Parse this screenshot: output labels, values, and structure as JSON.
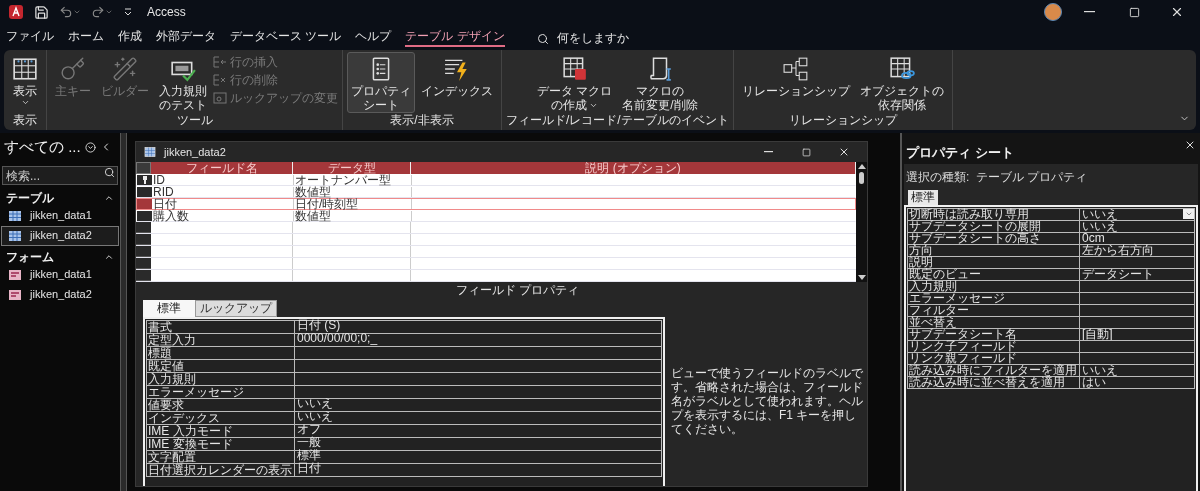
{
  "title_bar": {
    "app_name": "Access"
  },
  "menu_tabs": [
    {
      "label": "ファイル",
      "selected": false
    },
    {
      "label": "ホーム",
      "selected": false
    },
    {
      "label": "作成",
      "selected": false
    },
    {
      "label": "外部データ",
      "selected": false
    },
    {
      "label": "データベース ツール",
      "selected": false
    },
    {
      "label": "ヘルプ",
      "selected": false
    },
    {
      "label": "テーブル デザイン",
      "selected": true
    }
  ],
  "tell_me": {
    "placeholder": "何をしますか"
  },
  "ribbon_groups": [
    {
      "label": "表示",
      "items": [
        {
          "kind": "large",
          "lines": [
            "表示"
          ],
          "dropdown": true,
          "disabled": false,
          "selected": false
        }
      ]
    },
    {
      "label": "ツール",
      "items": [
        {
          "kind": "large",
          "lines": [
            "主キー"
          ],
          "dropdown": false,
          "disabled": true,
          "selected": false
        },
        {
          "kind": "large",
          "lines": [
            "ビルダー"
          ],
          "dropdown": false,
          "disabled": true,
          "selected": false
        },
        {
          "kind": "large",
          "lines": [
            "入力規則",
            "のテスト"
          ],
          "dropdown": false,
          "disabled": false,
          "selected": false
        },
        {
          "kind": "small",
          "lines": [
            "行の挿入"
          ],
          "disabled": true
        },
        {
          "kind": "small",
          "lines": [
            "行の削除"
          ],
          "disabled": true
        },
        {
          "kind": "small",
          "lines": [
            "ルックアップの変更"
          ],
          "disabled": true
        }
      ]
    },
    {
      "label": "表示/非表示",
      "items": [
        {
          "kind": "large",
          "lines": [
            "プロパティ",
            "シート"
          ],
          "dropdown": false,
          "disabled": false,
          "selected": true
        },
        {
          "kind": "large",
          "lines": [
            "インデックス"
          ],
          "dropdown": false,
          "disabled": false,
          "selected": false
        }
      ]
    },
    {
      "label": "フィールド/レコード/テーブルのイベント",
      "items": [
        {
          "kind": "large",
          "lines": [
            "データ マクロ",
            "の作成"
          ],
          "dropdown": true,
          "disabled": false,
          "selected": false
        },
        {
          "kind": "large",
          "lines": [
            "マクロの",
            "名前変更/削除"
          ],
          "dropdown": false,
          "disabled": false,
          "selected": false
        }
      ]
    },
    {
      "label": "リレーションシップ",
      "items": [
        {
          "kind": "large",
          "lines": [
            "リレーションシップ"
          ],
          "dropdown": false,
          "disabled": false,
          "selected": false
        },
        {
          "kind": "large",
          "lines": [
            "オブジェクトの",
            "依存関係"
          ],
          "dropdown": false,
          "disabled": false,
          "selected": false
        }
      ]
    }
  ],
  "navigation_pane": {
    "title": "すべての ...",
    "search": {
      "placeholder": "検索..."
    },
    "sections": [
      {
        "label": "テーブル",
        "expanded": true,
        "items": [
          {
            "kind": "table",
            "label": "jikken_data1",
            "selected": false
          },
          {
            "kind": "table",
            "label": "jikken_data2",
            "selected": true
          }
        ]
      },
      {
        "label": "フォーム",
        "expanded": true,
        "items": [
          {
            "kind": "form",
            "label": "jikken_data1",
            "selected": false
          },
          {
            "kind": "form",
            "label": "jikken_data2",
            "selected": false
          }
        ]
      }
    ]
  },
  "design_window": {
    "title": "jikken_data2",
    "columns": [
      "フィールド名",
      "データ型",
      "説明 (オプション)"
    ],
    "rows": [
      {
        "field": "ID",
        "type": "オートナンバー型",
        "primary_key": true,
        "selected": false
      },
      {
        "field": "RID",
        "type": "数値型",
        "primary_key": false,
        "selected": false
      },
      {
        "field": "日付",
        "type": "日付/時刻型",
        "primary_key": false,
        "selected": true
      },
      {
        "field": "購入数",
        "type": "数値型",
        "primary_key": false,
        "selected": false
      }
    ],
    "field_properties_label": "フィールド プロパティ",
    "property_tabs": [
      {
        "label": "標準",
        "selected": true
      },
      {
        "label": "ルックアップ",
        "selected": false
      }
    ],
    "properties": [
      {
        "name": "書式",
        "value": "日付 (S)"
      },
      {
        "name": "定型入力",
        "value": "0000/00/00;0;_"
      },
      {
        "name": "標題"
      },
      {
        "name": "既定値"
      },
      {
        "name": "入力規則"
      },
      {
        "name": "エラーメッセージ"
      },
      {
        "name": "値要求",
        "value": "いいえ"
      },
      {
        "name": "インデックス",
        "value": "いいえ"
      },
      {
        "name": "IME 入力モード",
        "value": "オフ"
      },
      {
        "name": "IME 変換モード",
        "value": "一般"
      },
      {
        "name": "文字配置",
        "value": "標準"
      },
      {
        "name": "日付選択カレンダーの表示",
        "value": "日付"
      }
    ],
    "help_text": "ビューで使うフィールドのラベルです。省略された場合は、フィールド名がラベルとして使われます。ヘルプを表示するには、F1 キーを押してください。"
  },
  "property_sheet": {
    "title": "プロパティ シート",
    "selection_type": "選択の種類:  テーブル プロパティ",
    "tabs": [
      {
        "label": "標準",
        "selected": true
      }
    ],
    "properties": [
      {
        "name": "切断時は読み取り専用",
        "value": "いいえ",
        "dropdown": true
      },
      {
        "name": "サブデータシートの展開",
        "value": "いいえ",
        "dropdown": false
      },
      {
        "name": "サブデータシートの高さ",
        "value": "0cm",
        "dropdown": false
      },
      {
        "name": "方向",
        "value": "左から右方向",
        "dropdown": false
      },
      {
        "name": "説明",
        "dropdown": false
      },
      {
        "name": "既定のビュー",
        "value": "データシート",
        "dropdown": false
      },
      {
        "name": "入力規則",
        "dropdown": false
      },
      {
        "name": "エラーメッセージ",
        "dropdown": false
      },
      {
        "name": "フィルター",
        "dropdown": false
      },
      {
        "name": "並べ替え",
        "dropdown": false
      },
      {
        "name": "サブデータシート名",
        "value": "[自動]",
        "dropdown": false
      },
      {
        "name": "リンク子フィールド",
        "dropdown": false
      },
      {
        "name": "リンク親フィールド",
        "dropdown": false
      },
      {
        "name": "読み込み時にフィルターを適用",
        "value": "いいえ",
        "dropdown": false
      },
      {
        "name": "読み込み時に並べ替えを適用",
        "value": "はい",
        "dropdown": false
      }
    ]
  }
}
